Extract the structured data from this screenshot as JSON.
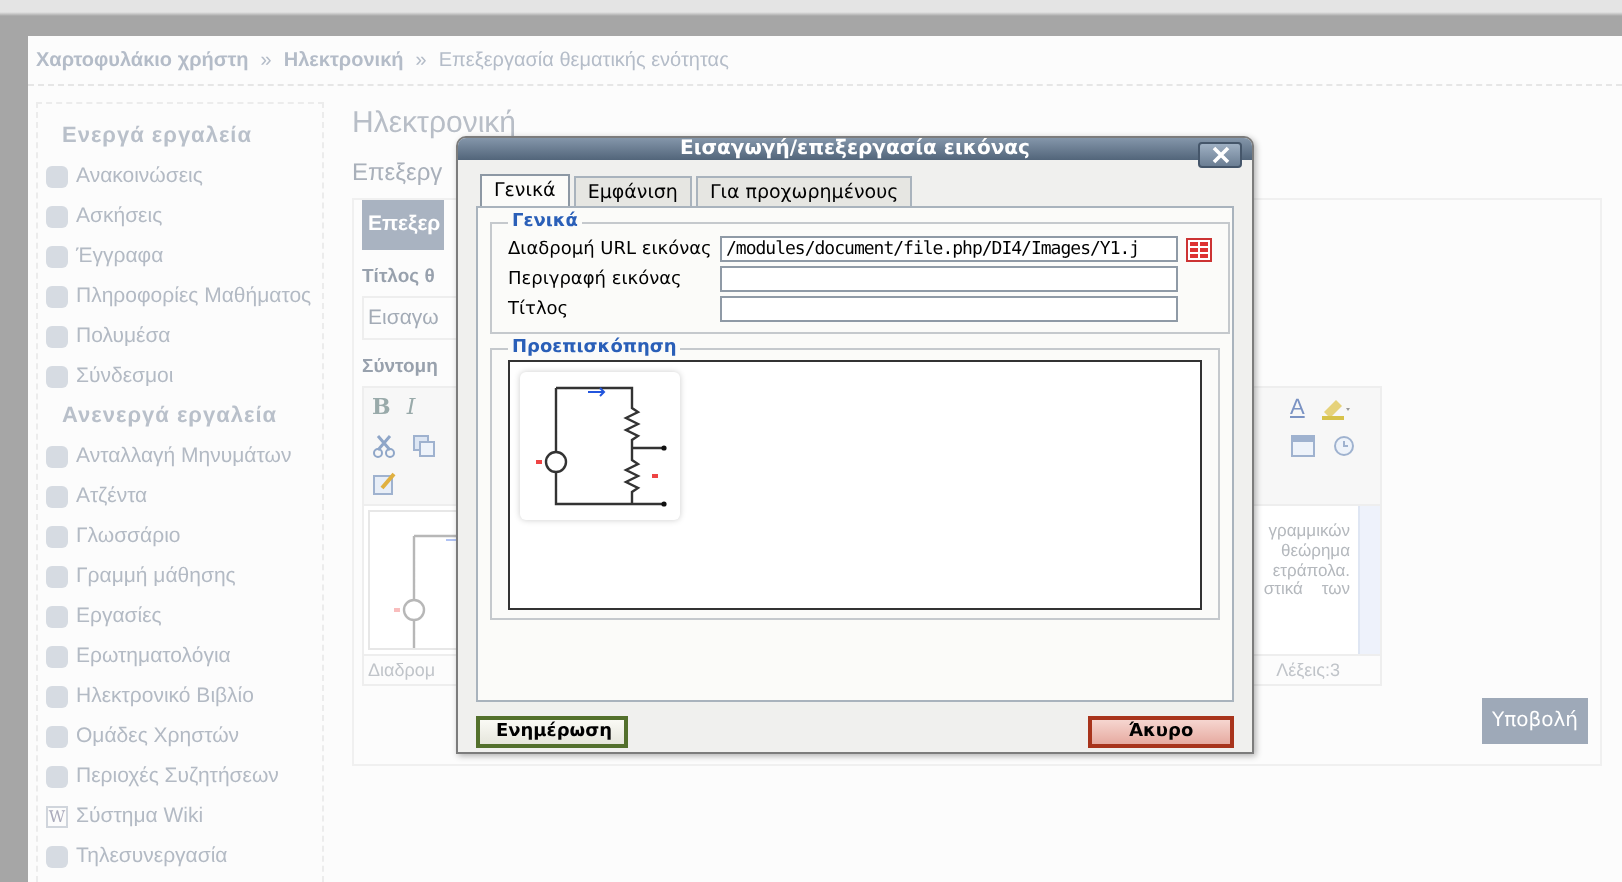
{
  "breadcrumb": [
    {
      "text": "Χαρτοφυλάκιο χρήστη"
    },
    {
      "sep": "»",
      "text": "Ηλεκτρονική"
    },
    {
      "sep": "»",
      "text": "Επεξεργασία θεματικής ενότητας"
    }
  ],
  "sidebar": {
    "sections": [
      {
        "title": "Ενεργά εργαλεία",
        "items": [
          {
            "label": "Ανακοινώσεις"
          },
          {
            "label": "Ασκήσεις"
          },
          {
            "label": "Έγγραφα"
          },
          {
            "label": "Πληροφορίες Μαθήματος"
          },
          {
            "label": "Πολυμέσα"
          },
          {
            "label": "Σύνδεσμοι"
          }
        ]
      },
      {
        "title": "Ανενεργά εργαλεία",
        "items": [
          {
            "label": "Ανταλλαγή Μηνυμάτων"
          },
          {
            "label": "Ατζέντα"
          },
          {
            "label": "Γλωσσάριο"
          },
          {
            "label": "Γραμμή μάθησης"
          },
          {
            "label": "Εργασίες"
          },
          {
            "label": "Ερωτηματολόγια"
          },
          {
            "label": "Ηλεκτρονικό Βιβλίο"
          },
          {
            "label": "Ομάδες Χρηστών"
          },
          {
            "label": "Περιοχές Συζητήσεων"
          },
          {
            "label": "Σύστημα Wiki",
            "icon_text": "W"
          },
          {
            "label": "Τηλεσυνεργασία"
          }
        ]
      }
    ]
  },
  "main": {
    "title": "Ηλεκτρονική",
    "subtitle": "Επεξεργ",
    "panel_tab": "Επεξερ",
    "field_label": "Τίτλος θ",
    "field_placeholder": "Εισαγω",
    "editor_label": "Σύντομη",
    "editor": {
      "toolbar_left": [
        "B",
        "I"
      ],
      "toolbar_right": [
        "A"
      ],
      "content_lines": [
        "γραμμικών",
        "θεώρημα",
        "ετράπολα.",
        "στικά    των"
      ],
      "path_label": "Διαδρομ",
      "word_count": "Λέξεις:3"
    },
    "submit": "Υποβολή"
  },
  "dialog": {
    "title": "Εισαγωγή/επεξεργασία εικόνας",
    "tabs": [
      {
        "label": "Γενικά",
        "selected": true
      },
      {
        "label": "Εμφάνιση",
        "selected": false
      },
      {
        "label": "Για προχωρημένους",
        "selected": false
      }
    ],
    "general": {
      "legend": "Γενικά",
      "fields": [
        {
          "label": "Διαδρομή URL εικόνας",
          "value": "/modules/document/file.php/DI4/Images/Y1.j",
          "browse": true
        },
        {
          "label": "Περιγραφή εικόνας",
          "browse": false
        },
        {
          "label": "Τίτλος",
          "browse": false
        }
      ]
    },
    "preview": {
      "legend": "Προεπισκόπηση"
    },
    "buttons": [
      {
        "label": "Ενημέρωση",
        "kind": "update"
      },
      {
        "label": "Άκυρο",
        "kind": "cancel"
      }
    ]
  }
}
